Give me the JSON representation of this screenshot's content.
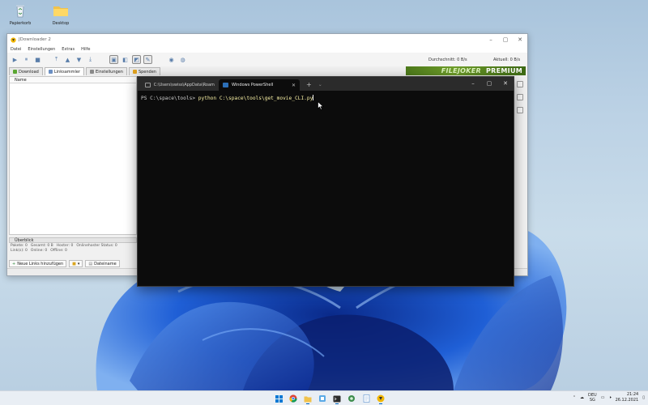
{
  "desktop": {
    "icons": [
      {
        "label": "Papierkorb",
        "icon": "recycle-bin-icon"
      },
      {
        "label": "Desktop",
        "icon": "folder-icon"
      }
    ]
  },
  "jdownloader": {
    "title": "JDownloader 2",
    "menu": [
      "Datei",
      "Einstellungen",
      "Extras",
      "Hilfe"
    ],
    "speed_average": "Durchschnitt: 0 B/s",
    "speed_current": "Aktuell: 0 B/s",
    "tabs": [
      {
        "label": "Download",
        "active": false
      },
      {
        "label": "Linksammler",
        "active": true
      },
      {
        "label": "Einstellungen",
        "active": false
      },
      {
        "label": "Spenden",
        "active": false
      }
    ],
    "premium_banner": {
      "brand": "FILEJOKER",
      "text": "PREMIUM"
    },
    "column_name": "Name",
    "overview": {
      "title": "Überblick",
      "rows": [
        [
          {
            "label": "Pakete:",
            "value": "0"
          },
          {
            "label": "Gesamt:",
            "value": "0 B"
          },
          {
            "label": "Hoster:",
            "value": "0"
          },
          {
            "label": "Onlinehoster Status:",
            "value": "0"
          }
        ],
        [
          {
            "label": "Link(s):",
            "value": "0"
          },
          {
            "label": "Online:",
            "value": "0"
          },
          {
            "label": "Offline:",
            "value": "0"
          }
        ]
      ]
    },
    "add_links_label": "Neue Links hinzufügen",
    "filename_label": "Dateiname"
  },
  "terminal": {
    "tabs": [
      {
        "label": "C:\\Users\\swiss\\AppData\\Roamin",
        "active": false
      },
      {
        "label": "Windows PowerShell",
        "active": true
      }
    ],
    "prompt": "PS C:\\space\\tools> ",
    "command": "python C:\\space\\tools\\get_movie_CLI.py"
  },
  "taskbar": {
    "language": "DEU",
    "region": "SG",
    "time": "21:24",
    "date": "26.12.2021"
  },
  "colors": {
    "accent": "#0067c0",
    "bloom": "#1f5fd6",
    "terminal_bg": "#0c0c0c",
    "premium_green": "#5a8a22"
  }
}
